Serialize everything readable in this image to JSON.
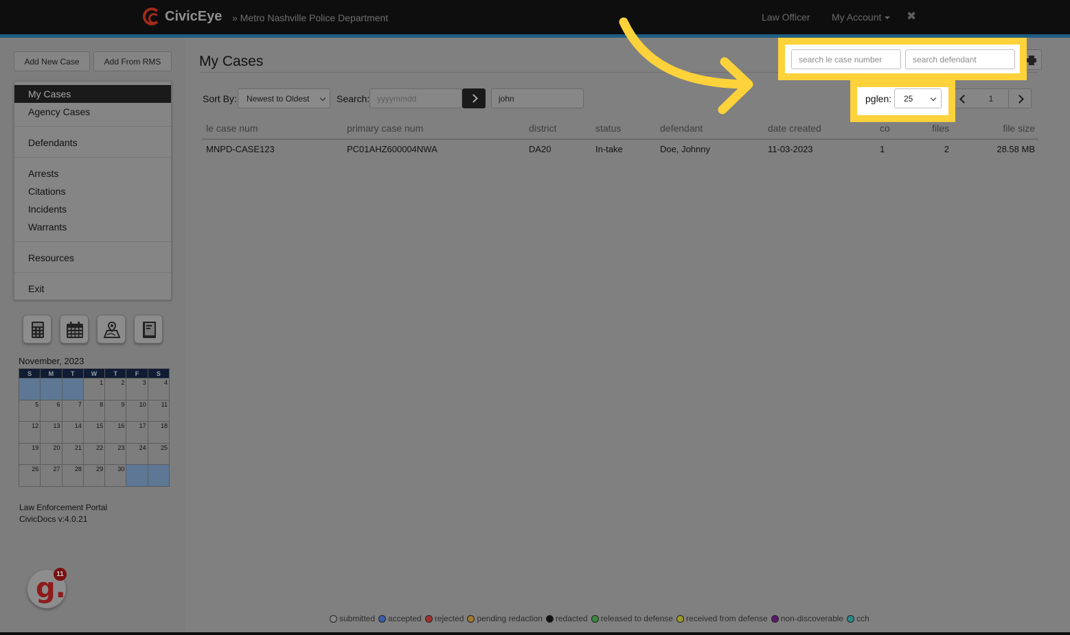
{
  "header": {
    "brand": "CivicEye",
    "department": "» Metro Nashville Police Department",
    "nav_law_officer": "Law Officer",
    "nav_my_account": "My Account"
  },
  "sidebar": {
    "add_new_case": "Add New Case",
    "add_from_rms": "Add From RMS",
    "menu": {
      "my_cases": "My Cases",
      "agency_cases": "Agency Cases",
      "defendants": "Defendants",
      "arrests": "Arrests",
      "citations": "Citations",
      "incidents": "Incidents",
      "warrants": "Warrants",
      "resources": "Resources",
      "exit": "Exit"
    },
    "tools": [
      "calculator-icon",
      "calendar-icon",
      "map-icon",
      "notebook-icon"
    ],
    "calendar": {
      "title": "November, 2023",
      "weekdays": [
        "S",
        "M",
        "T",
        "W",
        "T",
        "F",
        "S"
      ],
      "weeks": [
        [
          "",
          "",
          "",
          "1",
          "2",
          "3",
          "4"
        ],
        [
          "5",
          "6",
          "7",
          "8",
          "9",
          "10",
          "11"
        ],
        [
          "12",
          "13",
          "14",
          "15",
          "16",
          "17",
          "18"
        ],
        [
          "19",
          "20",
          "21",
          "22",
          "23",
          "24",
          "25"
        ],
        [
          "26",
          "27",
          "28",
          "29",
          "30",
          "",
          ""
        ]
      ]
    },
    "portal_name": "Law Enforcement Portal",
    "version": "CivicDocs v:4.0.21",
    "badge_count": "11",
    "badge_letter": "g."
  },
  "main": {
    "title": "My Cases",
    "sort_label": "Sort By:",
    "sort_value": "Newest to Oldest",
    "search_label": "Search:",
    "date_placeholder": "yyyymmdd",
    "text_search_value": "john",
    "case_number_placeholder": "search le case number",
    "defendant_placeholder": "search defendant",
    "pglen_label": "pglen:",
    "pglen_value": "25",
    "page_number": "1"
  },
  "table": {
    "headers": {
      "le_case_num": "le case num",
      "primary_case_num": "primary case num",
      "district": "district",
      "status": "status",
      "defendant": "defendant",
      "date_created": "date created",
      "co": "co",
      "files": "files",
      "file_size": "file size"
    },
    "rows": [
      {
        "le_case_num": "MNPD-CASE123",
        "primary_case_num": "PC01AHZ600004NWA",
        "district": "DA20",
        "status": "In-take",
        "defendant": "Doe, Johnny",
        "date_created": "11-03-2023",
        "co": "1",
        "files": "2",
        "file_size": "28.58 MB"
      }
    ]
  },
  "legend": [
    {
      "label": "submitted",
      "color": "#8a8a8a"
    },
    {
      "label": "accepted",
      "color": "#3b5ea8"
    },
    {
      "label": "rejected",
      "color": "#a03030"
    },
    {
      "label": "pending redaction",
      "color": "#a07a2e"
    },
    {
      "label": "redacted",
      "color": "#111111"
    },
    {
      "label": "released to defense",
      "color": "#3a8a3a"
    },
    {
      "label": "received from defense",
      "color": "#9a9a2a"
    },
    {
      "label": "non-discoverable",
      "color": "#5a1a6a"
    },
    {
      "label": "cch",
      "color": "#2a8a8a"
    }
  ],
  "annotation": {
    "highlight_color": "#fdd23a"
  }
}
